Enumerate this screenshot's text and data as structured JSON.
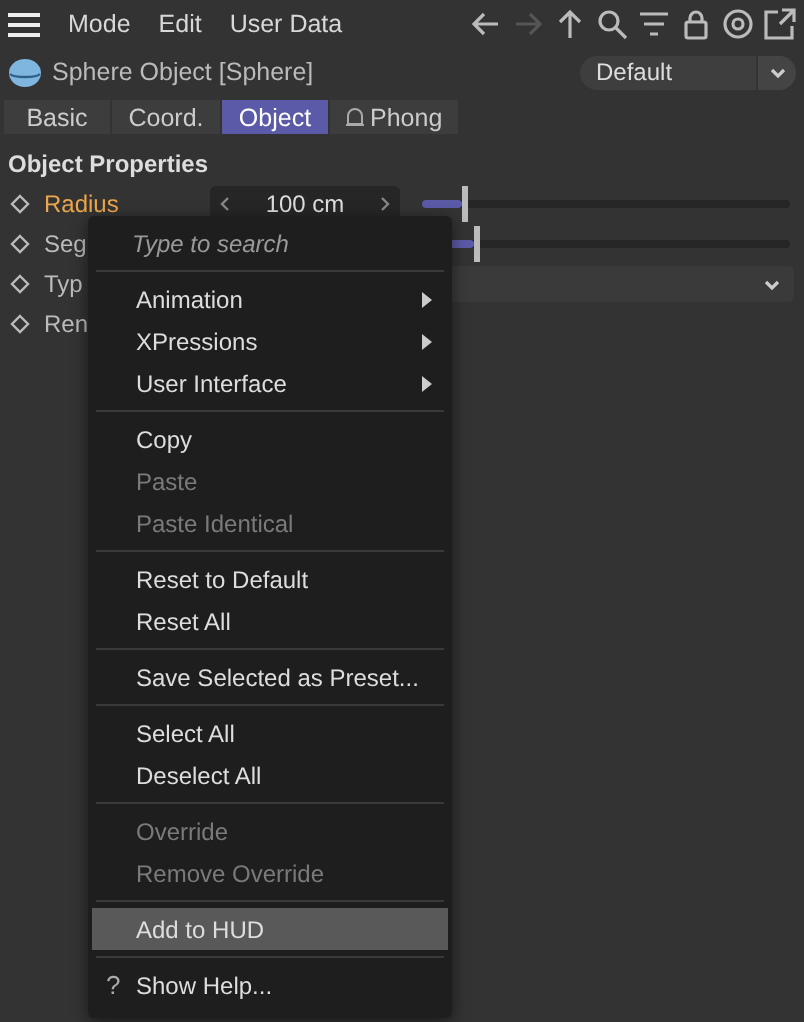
{
  "menubar": {
    "items": [
      "Mode",
      "Edit",
      "User Data"
    ]
  },
  "toolbar": [
    {
      "kind": "back",
      "disabled": false
    },
    {
      "kind": "forward",
      "disabled": true
    },
    {
      "kind": "up",
      "disabled": false
    },
    {
      "kind": "search",
      "disabled": false
    },
    {
      "kind": "filter",
      "disabled": false
    },
    {
      "kind": "lock",
      "disabled": false
    },
    {
      "kind": "target",
      "disabled": false
    },
    {
      "kind": "external",
      "disabled": false
    }
  ],
  "object": {
    "title": "Sphere Object [Sphere]",
    "preset": "Default"
  },
  "tabs": [
    {
      "label": "Basic",
      "selected": false,
      "locked": false
    },
    {
      "label": "Coord.",
      "selected": false,
      "locked": false
    },
    {
      "label": "Object",
      "selected": true,
      "locked": false
    },
    {
      "label": "Phong",
      "selected": false,
      "locked": true
    }
  ],
  "section_title": "Object Properties",
  "properties": [
    {
      "kind": "number",
      "label": "Radius",
      "highlighted": true,
      "value": "100 cm",
      "level": 0.11
    },
    {
      "kind": "slider",
      "label": "Seg",
      "highlighted": false,
      "level": 0.14
    },
    {
      "kind": "dropdown",
      "label": "Typ",
      "highlighted": false
    },
    {
      "kind": "plain",
      "label": "Ren",
      "highlighted": false
    }
  ],
  "context_menu": {
    "placeholder": "Type to search",
    "items": [
      {
        "kind": "separator"
      },
      {
        "kind": "item",
        "label": "Animation",
        "submenu": true,
        "disabled": false,
        "selected": false
      },
      {
        "kind": "item",
        "label": "XPressions",
        "submenu": true,
        "disabled": false,
        "selected": false
      },
      {
        "kind": "item",
        "label": "User Interface",
        "submenu": true,
        "disabled": false,
        "selected": false
      },
      {
        "kind": "separator"
      },
      {
        "kind": "item",
        "label": "Copy",
        "submenu": false,
        "disabled": false,
        "selected": false
      },
      {
        "kind": "item",
        "label": "Paste",
        "submenu": false,
        "disabled": true,
        "selected": false
      },
      {
        "kind": "item",
        "label": "Paste Identical",
        "submenu": false,
        "disabled": true,
        "selected": false
      },
      {
        "kind": "separator"
      },
      {
        "kind": "item",
        "label": "Reset to Default",
        "submenu": false,
        "disabled": false,
        "selected": false
      },
      {
        "kind": "item",
        "label": "Reset All",
        "submenu": false,
        "disabled": false,
        "selected": false
      },
      {
        "kind": "separator"
      },
      {
        "kind": "item",
        "label": "Save Selected as Preset...",
        "submenu": false,
        "disabled": false,
        "selected": false
      },
      {
        "kind": "separator"
      },
      {
        "kind": "item",
        "label": "Select All",
        "submenu": false,
        "disabled": false,
        "selected": false
      },
      {
        "kind": "item",
        "label": "Deselect All",
        "submenu": false,
        "disabled": false,
        "selected": false
      },
      {
        "kind": "separator"
      },
      {
        "kind": "item",
        "label": "Override",
        "submenu": false,
        "disabled": true,
        "selected": false
      },
      {
        "kind": "item",
        "label": "Remove Override",
        "submenu": false,
        "disabled": true,
        "selected": false
      },
      {
        "kind": "separator"
      },
      {
        "kind": "item",
        "label": "Add to HUD",
        "submenu": false,
        "disabled": false,
        "selected": true
      },
      {
        "kind": "separator"
      },
      {
        "kind": "item",
        "label": "Show Help...",
        "submenu": false,
        "disabled": false,
        "selected": false,
        "mark": "?"
      }
    ]
  }
}
